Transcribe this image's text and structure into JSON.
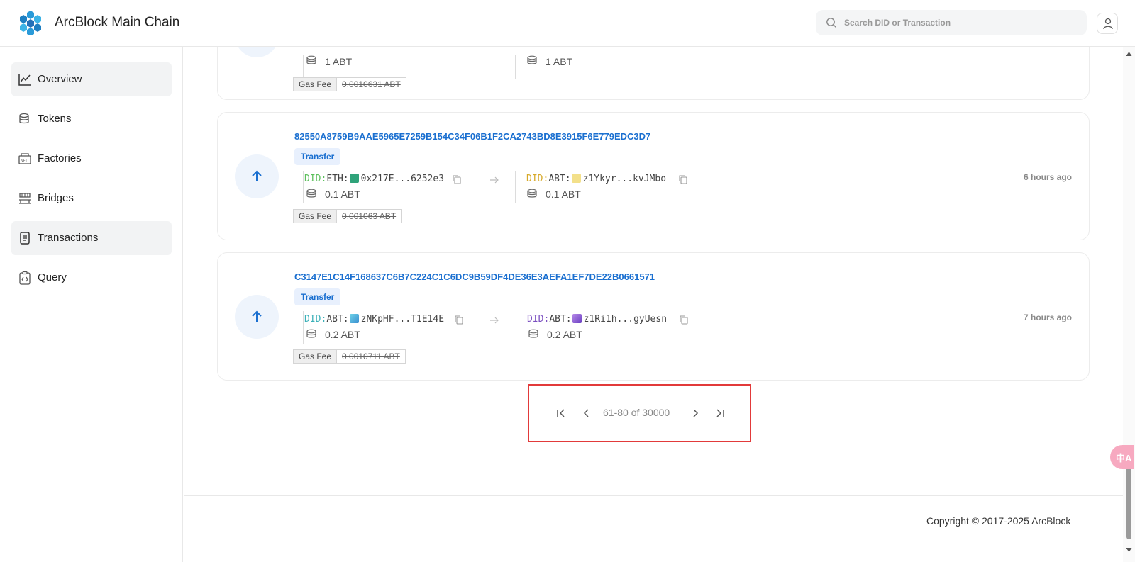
{
  "app": {
    "title": "ArcBlock Main Chain"
  },
  "search": {
    "placeholder": "Search DID or Transaction"
  },
  "sidebar": {
    "items": [
      {
        "label": "Overview",
        "active": true
      },
      {
        "label": "Tokens",
        "active": false
      },
      {
        "label": "Factories",
        "active": false
      },
      {
        "label": "Bridges",
        "active": false
      },
      {
        "label": "Transactions",
        "active": true
      },
      {
        "label": "Query",
        "active": false
      }
    ]
  },
  "transactions": [
    {
      "from_amount": "1 ABT",
      "to_amount": "1 ABT",
      "gas_label": "Gas Fee",
      "gas_value": "0.0010631 ABT"
    },
    {
      "hash": "82550A8759B9AAE5965E7259B154C34F06B1F2CA2743BD8E3915F6E779EDC3D7",
      "type": "Transfer",
      "from_prefix": "DID:",
      "from_chain": "ETH:",
      "from_addr": "0x217E...6252e3",
      "from_amount": "0.1 ABT",
      "to_prefix": "DID:",
      "to_chain": "ABT:",
      "to_addr": "z1Ykyr...kvJMbo",
      "to_amount": "0.1 ABT",
      "gas_label": "Gas Fee",
      "gas_value": "0.001063 ABT",
      "time": "6 hours ago"
    },
    {
      "hash": "C3147E1C14F168637C6B7C224C1C6DC9B59DF4DE36E3AEFA1EF7DE22B0661571",
      "type": "Transfer",
      "from_prefix": "DID:",
      "from_chain": "ABT:",
      "from_addr": "zNKpHF...T1E14E",
      "from_amount": "0.2 ABT",
      "to_prefix": "DID:",
      "to_chain": "ABT:",
      "to_addr": "z1Ri1h...gyUesn",
      "to_amount": "0.2 ABT",
      "gas_label": "Gas Fee",
      "gas_value": "0.0010711 ABT",
      "time": "7 hours ago"
    }
  ],
  "pagination": {
    "range": "61-80 of 30000"
  },
  "footer": {
    "copyright": "Copyright © 2017-2025  ArcBlock"
  },
  "translate": {
    "label": "中A"
  },
  "colors": {
    "link": "#1a6fd0",
    "highlight_box": "#e23a3a",
    "active_bg": "#f2f3f4"
  }
}
